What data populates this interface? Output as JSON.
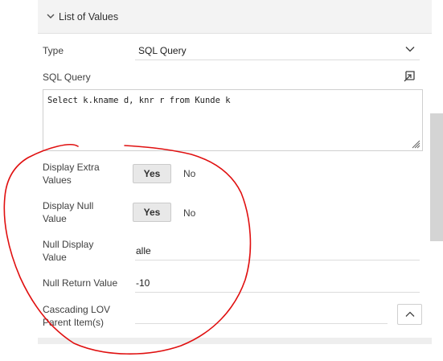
{
  "section": {
    "title": "List of Values",
    "expanded": true
  },
  "fields": {
    "type": {
      "label": "Type",
      "value": "SQL Query"
    },
    "sql_query": {
      "label": "SQL Query",
      "value": "Select k.kname d, knr r from Kunde k"
    },
    "display_extra_values": {
      "label_line1": "Display Extra",
      "label_line2": "Values",
      "yes": "Yes",
      "no": "No",
      "selected": "Yes"
    },
    "display_null_value": {
      "label_line1": "Display Null",
      "label_line2": "Value",
      "yes": "Yes",
      "no": "No",
      "selected": "Yes"
    },
    "null_display_value": {
      "label_line1": "Null Display",
      "label_line2": "Value",
      "value": "alle"
    },
    "null_return_value": {
      "label": "Null Return Value",
      "value": "-10"
    },
    "cascading_lov_parent": {
      "label_line1": "Cascading LOV",
      "label_line2": "Parent Item(s)",
      "value": ""
    }
  },
  "colors": {
    "annotation": "#e01010",
    "section_bg": "#f3f3f3",
    "toggle_selected_bg": "#e8e8e8",
    "scroll_thumb": "#d4d4d4"
  },
  "icons": {
    "collapse": "chevron-down-icon",
    "select": "chevron-down-icon",
    "expand_editor": "expand-icon",
    "resize": "resize-grip-icon",
    "picker": "chevron-up-icon"
  }
}
